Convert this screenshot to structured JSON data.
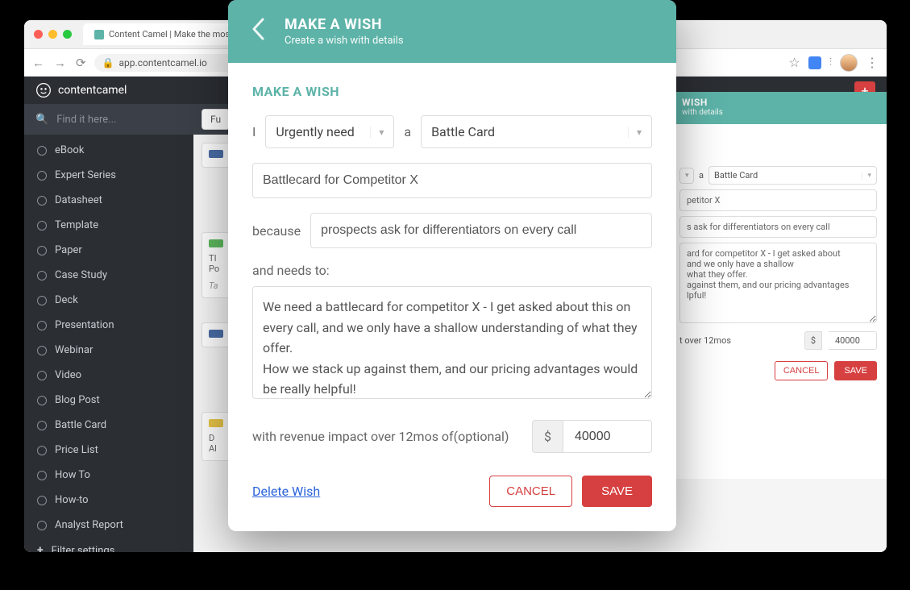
{
  "browser": {
    "tab_title": "Content Camel | Make the mos",
    "url": "app.contentcamel.io"
  },
  "app": {
    "logo_text": "contentcamel",
    "search_placeholder": "Find it here...",
    "filter_button": "Fu",
    "sidebar": {
      "items": [
        {
          "label": "eBook"
        },
        {
          "label": "Expert Series"
        },
        {
          "label": "Datasheet"
        },
        {
          "label": "Template"
        },
        {
          "label": "Paper"
        },
        {
          "label": "Case Study"
        },
        {
          "label": "Deck"
        },
        {
          "label": "Presentation"
        },
        {
          "label": "Webinar"
        },
        {
          "label": "Video"
        },
        {
          "label": "Blog Post"
        },
        {
          "label": "Battle Card"
        },
        {
          "label": "Price List"
        },
        {
          "label": "How To"
        },
        {
          "label": "How-to"
        },
        {
          "label": "Analyst Report"
        }
      ],
      "filter_link": "Filter settings..."
    },
    "cards": {
      "c1_line1": "TI",
      "c1_line2": "Po",
      "c1_tags": "Ta",
      "c2_line1": "D",
      "c2_line2": "Al"
    }
  },
  "bg_modal": {
    "title": "WISH",
    "subtitle": "with details",
    "select_a": "a",
    "select_value": "Battle Card",
    "field1": "petitor X",
    "field2": "s ask for differentiators on every call",
    "textarea": "ard for competitor X - I get asked about\nand we only have a shallow\nwhat they offer.\nagainst them, and our pricing advantages\nlpful!",
    "revenue_label": "t over 12mos",
    "currency": "$",
    "amount": "40000",
    "cancel": "CANCEL",
    "save": "SAVE"
  },
  "modal": {
    "header_title": "MAKE A WISH",
    "header_subtitle": "Create a wish with details",
    "section_title": "MAKE A WISH",
    "sentence": {
      "word_i": "I",
      "urgency": "Urgently need",
      "word_a": "a",
      "content_type": "Battle Card",
      "title_value": "Battlecard for Competitor X",
      "because": "because",
      "reason": "prospects ask for differentiators on every call",
      "needs_label": "and needs to:",
      "details": "We need a battlecard for competitor X - I get asked about this on every call, and we only have a shallow understanding of what they offer.\nHow we stack up against them, and our pricing advantages would be really helpful!",
      "revenue_label": "with revenue impact over 12mos of(optional)",
      "currency": "$",
      "amount": "40000"
    },
    "delete": "Delete Wish",
    "cancel": "CANCEL",
    "save": "SAVE"
  }
}
